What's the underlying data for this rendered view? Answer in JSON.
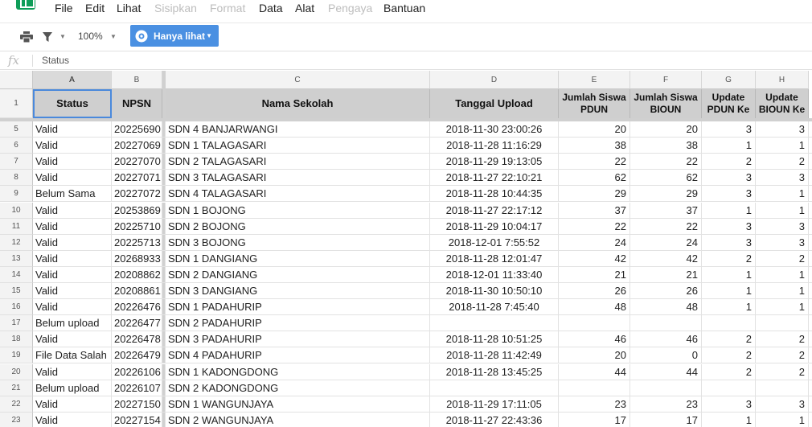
{
  "menu": [
    "File",
    "Edit",
    "Lihat",
    "Sisipkan",
    "Format",
    "Data",
    "Alat",
    "Pengaya",
    "Bantuan"
  ],
  "menu_disabled": [
    "Sisipkan",
    "Format",
    "Pengaya"
  ],
  "toolbar": {
    "zoom": "100%",
    "view_label": "Hanya lihat"
  },
  "formula": {
    "fx": "fx",
    "value": "Status"
  },
  "columns": [
    "A",
    "B",
    "C",
    "D",
    "E",
    "F",
    "G",
    "H"
  ],
  "header_row": {
    "num": "1",
    "cells": [
      "Status",
      "NPSN",
      "Nama Sekolah",
      "Tanggal Upload",
      "Jumlah Siswa PDUN",
      "Jumlah Siswa BIOUN",
      "Update PDUN Ke",
      "Update BIOUN Ke"
    ]
  },
  "rows": [
    {
      "num": "5",
      "cells": [
        "Valid",
        "20225690",
        "SDN 4 BANJARWANGI",
        "2018-11-30 23:00:26",
        "20",
        "20",
        "3",
        "3"
      ]
    },
    {
      "num": "6",
      "cells": [
        "Valid",
        "20227069",
        "SDN 1 TALAGASARI",
        "2018-11-28 11:16:29",
        "38",
        "38",
        "1",
        "1"
      ]
    },
    {
      "num": "7",
      "cells": [
        "Valid",
        "20227070",
        "SDN 2 TALAGASARI",
        "2018-11-29 19:13:05",
        "22",
        "22",
        "2",
        "2"
      ]
    },
    {
      "num": "8",
      "cells": [
        "Valid",
        "20227071",
        "SDN 3 TALAGASARI",
        "2018-11-27 22:10:21",
        "62",
        "62",
        "3",
        "3"
      ]
    },
    {
      "num": "9",
      "cells": [
        "Belum Sama",
        "20227072",
        "SDN 4 TALAGASARI",
        "2018-11-28 10:44:35",
        "29",
        "29",
        "3",
        "1"
      ]
    },
    {
      "num": "10",
      "cells": [
        "Valid",
        "20253869",
        "SDN 1 BOJONG",
        "2018-11-27 22:17:12",
        "37",
        "37",
        "1",
        "1"
      ]
    },
    {
      "num": "11",
      "cells": [
        "Valid",
        "20225710",
        "SDN 2 BOJONG",
        "2018-11-29 10:04:17",
        "22",
        "22",
        "3",
        "3"
      ]
    },
    {
      "num": "12",
      "cells": [
        "Valid",
        "20225713",
        "SDN 3 BOJONG",
        "2018-12-01 7:55:52",
        "24",
        "24",
        "3",
        "3"
      ]
    },
    {
      "num": "13",
      "cells": [
        "Valid",
        "20268933",
        "SDN 1 DANGIANG",
        "2018-11-28 12:01:47",
        "42",
        "42",
        "2",
        "2"
      ]
    },
    {
      "num": "14",
      "cells": [
        "Valid",
        "20208862",
        "SDN 2 DANGIANG",
        "2018-12-01 11:33:40",
        "21",
        "21",
        "1",
        "1"
      ]
    },
    {
      "num": "15",
      "cells": [
        "Valid",
        "20208861",
        "SDN 3 DANGIANG",
        "2018-11-30 10:50:10",
        "26",
        "26",
        "1",
        "1"
      ]
    },
    {
      "num": "16",
      "cells": [
        "Valid",
        "20226476",
        "SDN 1 PADAHURIP",
        "2018-11-28 7:45:40",
        "48",
        "48",
        "1",
        "1"
      ]
    },
    {
      "num": "17",
      "cells": [
        "Belum upload",
        "20226477",
        "SDN 2 PADAHURIP",
        "",
        "",
        "",
        "",
        ""
      ]
    },
    {
      "num": "18",
      "cells": [
        "Valid",
        "20226478",
        "SDN 3 PADAHURIP",
        "2018-11-28 10:51:25",
        "46",
        "46",
        "2",
        "2"
      ]
    },
    {
      "num": "19",
      "cells": [
        "File Data Salah",
        "20226479",
        "SDN 4 PADAHURIP",
        "2018-11-28 11:42:49",
        "20",
        "0",
        "2",
        "2"
      ]
    },
    {
      "num": "20",
      "cells": [
        "Valid",
        "20226106",
        "SDN 1 KADONGDONG",
        "2018-11-28 13:45:25",
        "44",
        "44",
        "2",
        "2"
      ]
    },
    {
      "num": "21",
      "cells": [
        "Belum upload",
        "20226107",
        "SDN 2 KADONGDONG",
        "",
        "",
        "",
        "",
        ""
      ]
    },
    {
      "num": "22",
      "cells": [
        "Valid",
        "20227150",
        "SDN 1 WANGUNJAYA",
        "2018-11-29 17:11:05",
        "23",
        "23",
        "3",
        "3"
      ]
    },
    {
      "num": "23",
      "cells": [
        "Valid",
        "20227154",
        "SDN 2 WANGUNJAYA",
        "2018-11-27 22:43:36",
        "17",
        "17",
        "1",
        "1"
      ]
    }
  ]
}
